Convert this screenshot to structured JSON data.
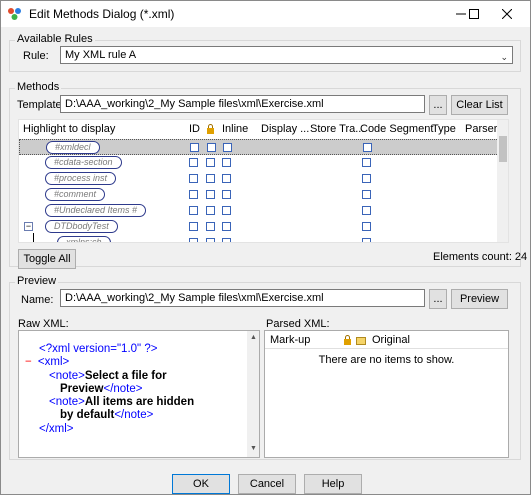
{
  "window": {
    "title": "Edit Methods Dialog (*.xml)"
  },
  "available_rules": {
    "group_label": "Available Rules",
    "rule_label": "Rule:",
    "rule_value": "My XML rule A"
  },
  "methods": {
    "group_label": "Methods",
    "template_label": "Template:",
    "template_value": "D:\\AAA_working\\2_My Sample files\\xml\\Exercise.xml",
    "browse_label": "...",
    "clear_list_label": "Clear List",
    "columns": [
      "Highlight to display",
      "ID",
      "",
      "Inline",
      "Display ...",
      "Store Tra...",
      "Code Segment",
      "Type",
      "Parser"
    ],
    "rows": [
      {
        "tag": "#xmldecl",
        "indent": 0
      },
      {
        "tag": "#cdata-section",
        "indent": 0
      },
      {
        "tag": "#process inst",
        "indent": 0
      },
      {
        "tag": "#comment",
        "indent": 0
      },
      {
        "tag": "#Undeclared Items #",
        "indent": 0
      },
      {
        "tag": "DTDbodyTest",
        "indent": 0,
        "expander": "−"
      },
      {
        "tag": "xmlns:ch",
        "indent": 1
      }
    ],
    "toggle_all_label": "Toggle All",
    "elements_count": "Elements count: 24"
  },
  "preview": {
    "group_label": "Preview",
    "name_label": "Name:",
    "name_value": "D:\\AAA_working\\2_My Sample files\\xml\\Exercise.xml",
    "browse_label": "...",
    "preview_button": "Preview",
    "raw_xml_label": "Raw XML:",
    "parsed_xml_label": "Parsed XML:",
    "parsed_columns": [
      "Mark-up",
      "",
      "",
      "Original"
    ],
    "empty_message": "There are no items to show.",
    "raw_xml": {
      "decl": "<?xml version=\"1.0\" ?>",
      "collapse": "−",
      "xml_open": "<xml>",
      "note_open": "<note>",
      "text1a": "Select a file for",
      "text1b": "Preview",
      "note_close": "</note>",
      "text2a": "All items are hidden",
      "text2b": "by default",
      "xml_close": "</xml>"
    }
  },
  "footer": {
    "ok": "OK",
    "cancel": "Cancel",
    "help": "Help"
  },
  "colors": {
    "accent": "#0078d7",
    "tag_border": "#2e3a8c",
    "xml_blue": "#0000ff",
    "xml_maroon": "#990000"
  }
}
